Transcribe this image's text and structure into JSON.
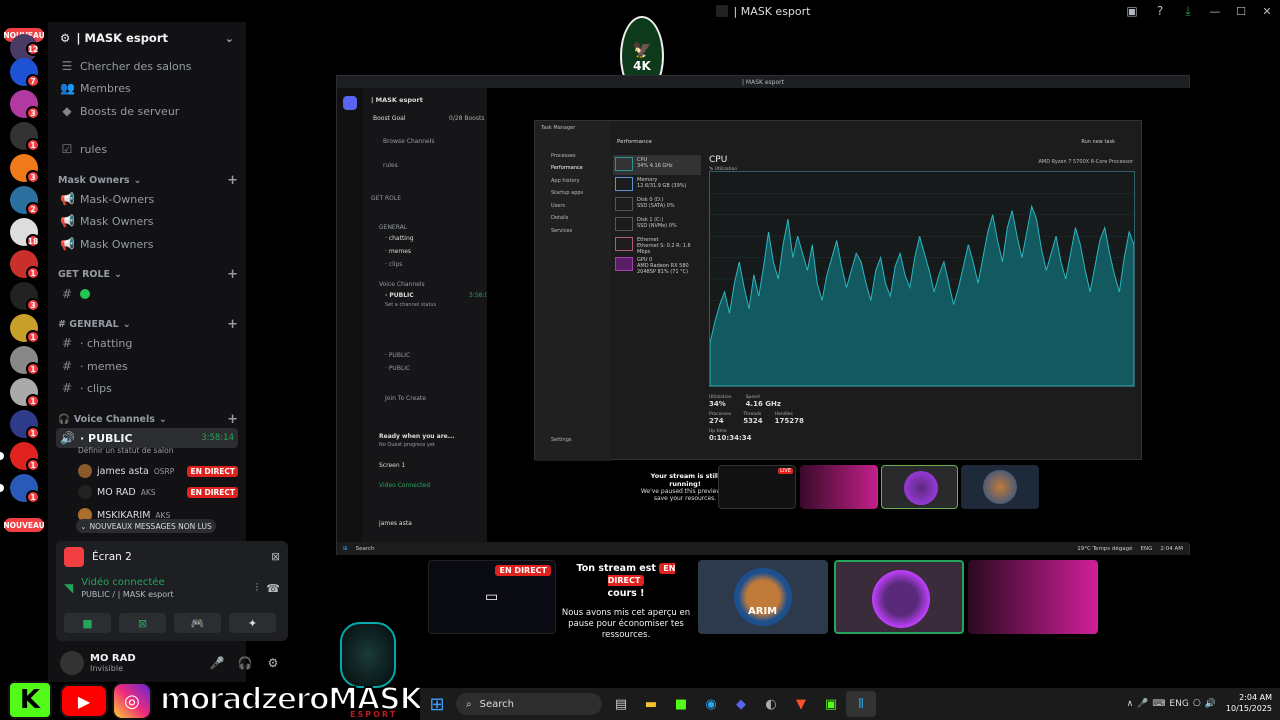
{
  "window": {
    "title": "| MASK esport"
  },
  "rail": {
    "nouveau_top": "NOUVEAU",
    "nouveau_bottom": "NOUVEAU",
    "badges": [
      "12",
      "7",
      "3",
      "1",
      "3",
      "2",
      "18",
      "1",
      "3",
      "1",
      "1",
      "1",
      "1",
      "1",
      "1"
    ]
  },
  "sidebar": {
    "server_name": "| MASK esport",
    "browse": "Chercher des salons",
    "members": "Membres",
    "boosts": "Boosts de serveur",
    "rules": "rules",
    "cat_mask_owners": "Mask Owners",
    "ch_mask_owners1": "Mask-Owners",
    "ch_mask_owners2": "Mask Owners",
    "ch_mask_owners3": "Mask Owners",
    "cat_get_role": "GET ROLE",
    "cat_general": "# GENERAL",
    "ch_chatting": "· chatting",
    "ch_memes": "· memes",
    "ch_clips": "· clips",
    "cat_voice": "Voice Channels",
    "voice_public": "· PUBLIC",
    "voice_timer": "3:58:14",
    "voice_status": "Définir un statut de salon",
    "vc_users": [
      {
        "name": "james asta",
        "tag": "OSRP"
      },
      {
        "name": "MO RAD",
        "tag": "AKS"
      },
      {
        "name": "MSKIKARIM",
        "tag": "AKS"
      }
    ],
    "live_label": "EN DIRECT",
    "new_msgs": "NOUVEAUX MESSAGES NON LUS"
  },
  "voice_panel": {
    "screen_label": "Écran 2",
    "connected": "Vidéo connectée",
    "channel": "PUBLIC / | MASK esport"
  },
  "user_panel": {
    "name": "MO RAD",
    "status": "Invisible"
  },
  "nested": {
    "title": "| MASK esport",
    "server": "| MASK esport",
    "boost_goal": "Boost Goal",
    "boost_count": "0/28 Boosts",
    "browse": "Browse Channels",
    "rules": "rules",
    "get_role": "GET ROLE",
    "general": "GENERAL",
    "chatting": "· chatting",
    "memes": "· memes",
    "clips": "· clips",
    "voice_channels": "Voice Channels",
    "public": "· PUBLIC",
    "timer": "3:58:09",
    "set_status": "Set a channel status",
    "public2": "· PUBLIC",
    "public3": "· PUBLIC",
    "join_to_create": "Join To Create",
    "ready": "Ready when you are...",
    "quest": "No Quest progress yet",
    "screen1": "Screen 1",
    "video_connected": "Video Connected",
    "user": "james asta",
    "search": "Search",
    "weather": "19°C Temps dégagé",
    "eng": "ENG",
    "clock": "2:04 AM"
  },
  "task_manager": {
    "title": "Task Manager",
    "run_new_task": "Run new task",
    "section": "Performance",
    "nav": [
      "Processes",
      "Performance",
      "App history",
      "Startup apps",
      "Users",
      "Details",
      "Services"
    ],
    "settings": "Settings",
    "cpu_title": "CPU",
    "cpu_sub": "% Utilization",
    "processor": "AMD Ryzen 7 5700X 8-Core Processor",
    "list": [
      {
        "name": "CPU",
        "val": "34% 4.16 GHz"
      },
      {
        "name": "Memory",
        "val": "12.6/31.9 GB (39%)"
      },
      {
        "name": "Disk 0 (D:)",
        "val": "SSD (SATA) 0%"
      },
      {
        "name": "Disk 1 (C:)",
        "val": "SSD (NVMe) 0%"
      },
      {
        "name": "Ethernet",
        "val": "Ethernet S: 0.2 R: 1.6 Mbps"
      },
      {
        "name": "GPU 0",
        "val": "AMD Radeon RX 580 2048SP 81% (71 °C)"
      }
    ],
    "utilization": "34%",
    "speed": "4.16 GHz",
    "processes": "274",
    "threads": "5324",
    "handles": "175278",
    "uptime": "0:10:34:34",
    "utilization_label": "Utilization",
    "speed_label": "Speed",
    "processes_label": "Processes",
    "threads_label": "Threads",
    "handles_label": "Handles",
    "uptime_label": "Up time",
    "series": [
      20,
      30,
      38,
      44,
      34,
      48,
      58,
      46,
      36,
      52,
      42,
      56,
      72,
      58,
      50,
      66,
      78,
      60,
      70,
      62,
      54,
      66,
      48,
      40,
      52,
      60,
      68,
      56,
      46,
      54,
      62,
      58,
      48,
      40,
      54,
      60,
      48,
      42,
      56,
      62,
      52,
      46,
      60,
      70,
      62,
      54,
      44,
      52,
      58,
      48,
      38,
      46,
      56,
      66,
      58,
      48,
      60,
      72,
      80,
      68,
      58,
      74,
      82,
      70,
      60,
      72,
      84,
      78,
      64,
      54,
      62,
      70,
      58,
      50,
      62,
      74,
      66,
      54,
      44,
      56,
      68,
      74,
      62,
      52,
      44,
      60,
      72,
      66
    ]
  },
  "previews": {
    "small_stream_msg_title": "Your stream is still running!",
    "small_stream_msg_sub": "We've paused this preview to save your resources.",
    "live": "LIVE",
    "big_msg_title_1": "Ton stream est",
    "big_msg_title_2": "cours !",
    "big_msg_sub": "Nous avons mis cet aperçu en pause pour économiser tes ressources.",
    "en_direct": "EN DIRECT",
    "arim": "ARIM"
  },
  "branding": {
    "name": "moradzero",
    "mask": "MASK",
    "esport": "ESPORT",
    "ak": "4K"
  },
  "taskbar": {
    "search": "Search",
    "lang": "ENG",
    "time": "2:04 AM",
    "date": "10/15/2025"
  }
}
